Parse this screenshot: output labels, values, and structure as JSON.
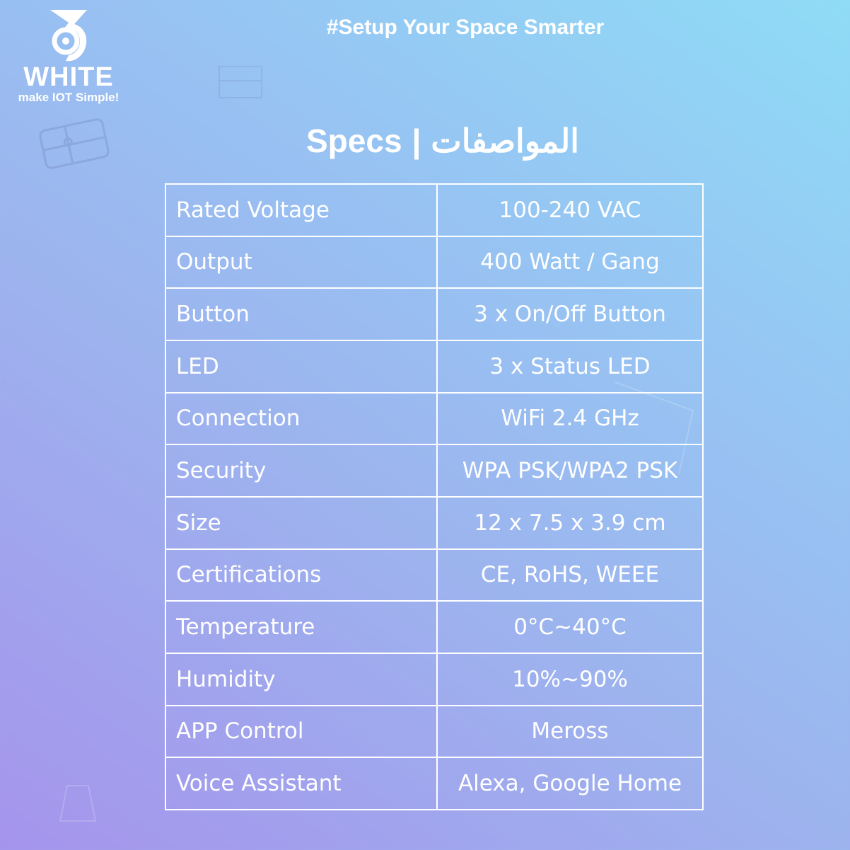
{
  "brand": {
    "name": "WHITE",
    "tagline": "make IOT Simple!",
    "logo_icon": "white-iot-logo-icon"
  },
  "header": {
    "tagline": "#Setup Your Space Smarter",
    "title_en": "Specs",
    "title_separator": "|",
    "title_ar": "المواصفات"
  },
  "specs": {
    "rows": [
      {
        "label": "Rated Voltage",
        "value": "100-240 VAC"
      },
      {
        "label": "Output",
        "value": "400 Watt / Gang"
      },
      {
        "label": "Button",
        "value": "3 x On/Off Button"
      },
      {
        "label": "LED",
        "value": "3 x Status LED"
      },
      {
        "label": "Connection",
        "value": "WiFi 2.4 GHz"
      },
      {
        "label": "Security",
        "value": "WPA PSK/WPA2 PSK"
      },
      {
        "label": "Size",
        "value": "12 x 7.5 x 3.9 cm"
      },
      {
        "label": "Certifications",
        "value": "CE, RoHS, WEEE"
      },
      {
        "label": "Temperature",
        "value": "0°C~40°C"
      },
      {
        "label": "Humidity",
        "value": "10%~90%"
      },
      {
        "label": "APP Control",
        "value": "Meross"
      },
      {
        "label": "Voice Assistant",
        "value": "Alexa, Google Home"
      }
    ]
  },
  "colors": {
    "background_top_right": "#8fdcf6",
    "background_bottom_left": "#a594ec",
    "text": "#ffffff",
    "table_border": "#ffffff"
  }
}
